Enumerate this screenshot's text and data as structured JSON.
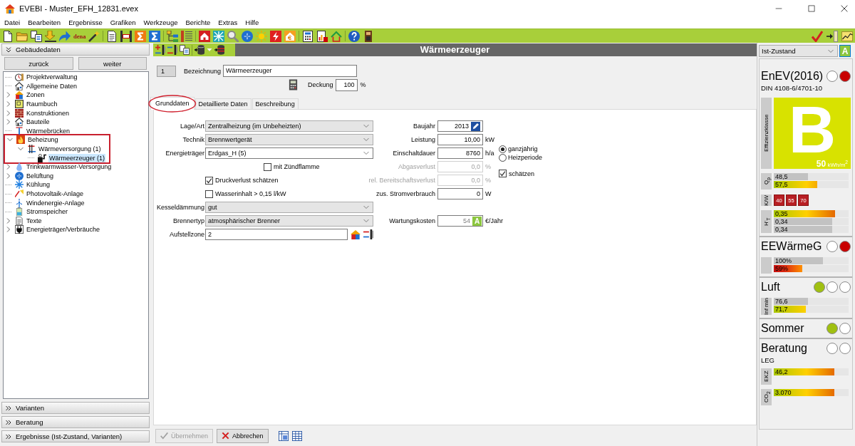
{
  "window": {
    "title": "EVEBI - Muster_EFH_12831.evex"
  },
  "menu": [
    "Datei",
    "Bearbeiten",
    "Ergebnisse",
    "Grafiken",
    "Werkzeuge",
    "Berichte",
    "Extras",
    "Hilfe"
  ],
  "toolbar": {
    "logo": "dena"
  },
  "sidebar": {
    "top_section": {
      "label": "Gebäudedaten",
      "expanded": true
    },
    "nav_buttons": [
      "zurück",
      "weiter"
    ],
    "tree": [
      {
        "label": "Projektverwaltung",
        "expandable": false,
        "expanded": false,
        "selected": false,
        "marked": false
      },
      {
        "label": "Allgemeine Daten",
        "expandable": false,
        "expanded": false,
        "selected": false,
        "marked": false
      },
      {
        "label": "Zonen",
        "expandable": true,
        "expanded": false,
        "selected": false,
        "marked": false
      },
      {
        "label": "Raumbuch",
        "expandable": true,
        "expanded": false,
        "selected": false,
        "marked": false
      },
      {
        "label": "Konstruktionen",
        "expandable": true,
        "expanded": false,
        "selected": false,
        "marked": false
      },
      {
        "label": "Bauteile",
        "expandable": true,
        "expanded": false,
        "selected": false,
        "marked": false
      },
      {
        "label": "Wärmebrücken",
        "expandable": false,
        "expanded": false,
        "selected": false,
        "marked": false
      },
      {
        "label": "Beheizung",
        "expandable": true,
        "expanded": true,
        "selected": false,
        "marked": true,
        "children": [
          {
            "label": "Wärmeversorgung (1)",
            "expandable": true,
            "expanded": true,
            "selected": false,
            "marked": false,
            "children": [
              {
                "label": "Wärmeerzeuger (1)",
                "expandable": false,
                "expanded": false,
                "selected": true,
                "marked": false
              }
            ]
          }
        ]
      },
      {
        "label": "Trinkwarmwasser-Versorgung",
        "expandable": true,
        "expanded": false,
        "selected": false,
        "marked": false
      },
      {
        "label": "Belüftung",
        "expandable": true,
        "expanded": false,
        "selected": false,
        "marked": false
      },
      {
        "label": "Kühlung",
        "expandable": false,
        "expanded": false,
        "selected": false,
        "marked": false
      },
      {
        "label": "Photovoltaik-Anlage",
        "expandable": false,
        "expanded": false,
        "selected": false,
        "marked": false
      },
      {
        "label": "Windenergie-Anlage",
        "expandable": false,
        "expanded": false,
        "selected": false,
        "marked": false
      },
      {
        "label": "Stromspeicher",
        "expandable": false,
        "expanded": false,
        "selected": false,
        "marked": false
      },
      {
        "label": "Texte",
        "expandable": true,
        "expanded": false,
        "selected": false,
        "marked": false
      },
      {
        "label": "Energieträger/Verbräuche",
        "expandable": true,
        "expanded": false,
        "selected": false,
        "marked": false
      }
    ],
    "bottom_sections": [
      {
        "label": "Varianten",
        "expanded": false
      },
      {
        "label": "Beratung",
        "expanded": false
      },
      {
        "label": "Ergebnisse (Ist-Zustand, Varianten)",
        "expanded": false
      }
    ]
  },
  "main": {
    "title": "Wärmeerzeuger",
    "index": "1",
    "name_field": {
      "label": "Bezeichnung",
      "value": "Wärmeerzeuger"
    },
    "coverage_field": {
      "label": "Deckung",
      "value": "100",
      "unit": "%"
    },
    "tabs": [
      {
        "label": "Grunddaten",
        "selected": true,
        "marked": true
      },
      {
        "label": "Detaillierte Daten",
        "selected": false,
        "marked": false
      },
      {
        "label": "Beschreibung",
        "selected": false,
        "marked": false
      }
    ],
    "left_fields": [
      {
        "kind": "select",
        "label": "Lage/Art",
        "value": "Zentralheizung (im Unbeheizten)"
      },
      {
        "kind": "select",
        "label": "Technik",
        "value": "Brennwertgerät"
      },
      {
        "kind": "combo",
        "label": "Energieträger",
        "value": "Erdgas_H (5)",
        "option": {
          "label": "mit Zündflamme",
          "checked": false
        }
      },
      {
        "kind": "checkbox",
        "label": "Druckverlust schätzen",
        "checked": true
      },
      {
        "kind": "checkbox",
        "label": "Wasserinhalt > 0,15 l/kW",
        "checked": false
      },
      {
        "kind": "select",
        "label": "Kesseldämmung",
        "value": "gut"
      },
      {
        "kind": "select",
        "label": "Brennertyp",
        "value": "atmosphärischer Brenner"
      },
      {
        "kind": "picker",
        "label": "Aufstellzone",
        "value": "2"
      }
    ],
    "right_fields": [
      {
        "kind": "year",
        "label": "Baujahr",
        "value": "2013",
        "disabled": false
      },
      {
        "kind": "number",
        "label": "Leistung",
        "value": "10,00",
        "unit": "kW",
        "disabled": false
      },
      {
        "kind": "number",
        "label": "Einschaltdauer",
        "value": "8760",
        "unit": "h/a",
        "disabled": false,
        "radios": [
          {
            "label": "ganzjährig",
            "selected": true
          },
          {
            "label": "Heizperiode",
            "selected": false
          }
        ]
      },
      {
        "kind": "number",
        "label": "Abgasverlust",
        "value": "0,0",
        "unit": "%",
        "disabled": true,
        "estimate": {
          "label": "schätzen",
          "checked": true
        }
      },
      {
        "kind": "number",
        "label": "rel. Bereitschaftsverlust",
        "value": "0,0",
        "unit": "%",
        "disabled": true
      },
      {
        "kind": "number",
        "label": "zus. Stromverbrauch",
        "value": "0",
        "unit": "W",
        "disabled": false
      }
    ],
    "maintenance": {
      "label": "Wartungskosten",
      "value": "54",
      "badge": "A",
      "unit": "€/Jahr"
    },
    "actions": [
      {
        "kind": "apply",
        "label": "Übernehmen",
        "disabled": true
      },
      {
        "kind": "cancel",
        "label": "Abbrechen",
        "disabled": false
      }
    ]
  },
  "assessment": {
    "variant": "Ist-Zustand",
    "badge": "A",
    "sections": [
      {
        "title": "EnEV(2016)",
        "lights": [
          {
            "color": "#ffffff"
          },
          {
            "color": "#c80000"
          }
        ],
        "subtitle": "DIN 4108-6/4701-10",
        "efficiency": {
          "label": "Effizienzklasse",
          "class": "B",
          "value": "50",
          "unit": "kWh/m$^{2}$"
        },
        "groups": [
          {
            "label": "Q$_{p}$",
            "bars": [
              {
                "kind": "reference",
                "value": "48,5",
                "level": 0.46
              },
              {
                "kind": "scale",
                "value": "57,5",
                "level": 0.58
              }
            ]
          },
          {
            "label": "K/W",
            "tiles": [
              "40",
              "55",
              "70"
            ]
          },
          {
            "label": "H'$_{T}$",
            "bars": [
              {
                "kind": "scale",
                "value": "0,35",
                "level": 0.82
              },
              {
                "kind": "reference",
                "value": "0,34",
                "level": 0.78
              },
              {
                "kind": "reference",
                "value": "0,34",
                "level": 0.78
              }
            ]
          }
        ]
      },
      {
        "title": "EEWärmeG",
        "lights": [
          {
            "color": "#ffffff"
          },
          {
            "color": "#c80000"
          }
        ],
        "groups": [
          {
            "bars": [
              {
                "kind": "reference",
                "value": "100%",
                "level": 0.66
              },
              {
                "kind": "alarm",
                "value": "59%",
                "level": 0.38
              }
            ]
          }
        ]
      },
      {
        "title": "Luft",
        "lights": [
          {
            "color": "#a0c010"
          },
          {
            "color": "#ffffff"
          },
          {
            "color": "#ffffff"
          }
        ],
        "groups": [
          {
            "label": "Inf min",
            "bars": [
              {
                "kind": "reference",
                "value": "76,6",
                "level": 0.46
              },
              {
                "kind": "scale",
                "value": "71,7",
                "level": 0.43
              }
            ]
          }
        ]
      },
      {
        "title": "Sommer",
        "lights": [
          {
            "color": "#a0c010"
          },
          {
            "color": "#ffffff"
          }
        ]
      },
      {
        "title": "Beratung",
        "lights": [
          {
            "color": "#ffffff"
          },
          {
            "color": "#ffffff"
          }
        ],
        "subtitle": "LEG",
        "groups": [
          {
            "label": "EKZ",
            "bars": [
              {
                "kind": "scale",
                "value": "46,2",
                "level": 0.81
              }
            ]
          },
          {
            "label": "CO$_{2}$",
            "bars": [
              {
                "kind": "scale",
                "value": "3.070",
                "level": 0.81
              }
            ]
          }
        ]
      }
    ]
  }
}
